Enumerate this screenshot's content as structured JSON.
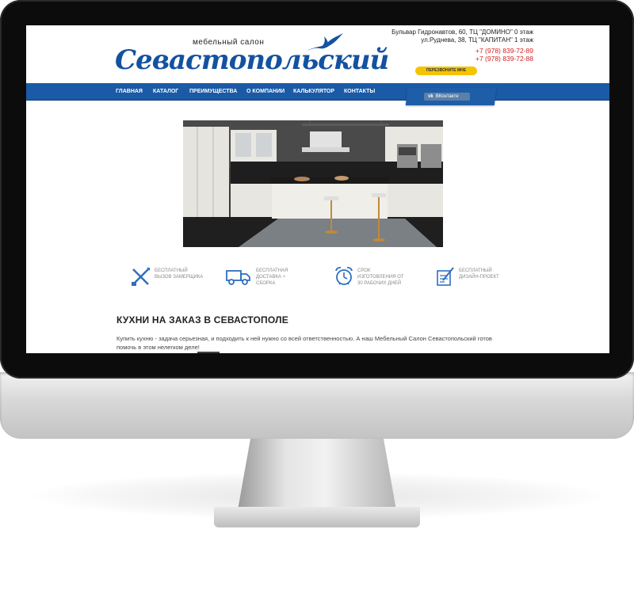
{
  "logo": {
    "subtitle": "мебельный салон",
    "name": "Севастопольский"
  },
  "contacts": {
    "address1": "Бульвар Гидронавтов, 60, ТЦ \"ДОМИНО\" 0 этаж",
    "address2": "ул.Руднева, 38, ТЦ \"КАПИТАН\" 1 этаж",
    "phone1": "+7 (978) 839-72-89",
    "phone2": "+7 (978) 839-72-88",
    "callback_label": "ПЕРЕЗВОНИТЕ МНЕ"
  },
  "nav": {
    "items": [
      "ГЛАВНАЯ",
      "КАТАЛОГ",
      "ПРЕИМУЩЕСТВА",
      "О КОМПАНИИ",
      "КАЛЬКУЛЯТОР",
      "КОНТАКТЫ"
    ]
  },
  "social": {
    "vk_label": "ВКонтакте",
    "vk_logo": "vk"
  },
  "features": [
    {
      "icon": "measure-tools-icon",
      "line1": "БЕСПЛАТНЫЙ",
      "line2": "ВЫЗОВ ЗАМЕРЩИКА",
      "line3": ""
    },
    {
      "icon": "truck-icon",
      "line1": "БЕСПЛАТНАЯ",
      "line2": "ДОСТАВКА +",
      "line3": "СБОРКА"
    },
    {
      "icon": "alarm-clock-icon",
      "line1": "СРОК",
      "line2": "ИЗГОТОВЛЕНИЯ ОТ",
      "line3": "30 РАБОЧИХ ДНЕЙ"
    },
    {
      "icon": "design-project-icon",
      "line1": "БЕСПЛАТНЫЙ",
      "line2": "ДИЗАЙН-ПРОЕКТ",
      "line3": ""
    }
  ],
  "main": {
    "heading": "КУХНИ НА ЗАКАЗ В СЕВАСТОПОЛЕ",
    "paragraph": "Купить кухню - задача серьезная, и подходить к ней нужно со всей ответственностью. А наш Мебельный Салон Севастопольский готов помочь в этом нелегком деле!"
  },
  "colors": {
    "brand_blue": "#1a5aa6",
    "accent_yellow": "#f5c400",
    "phone_red": "#d42020"
  }
}
